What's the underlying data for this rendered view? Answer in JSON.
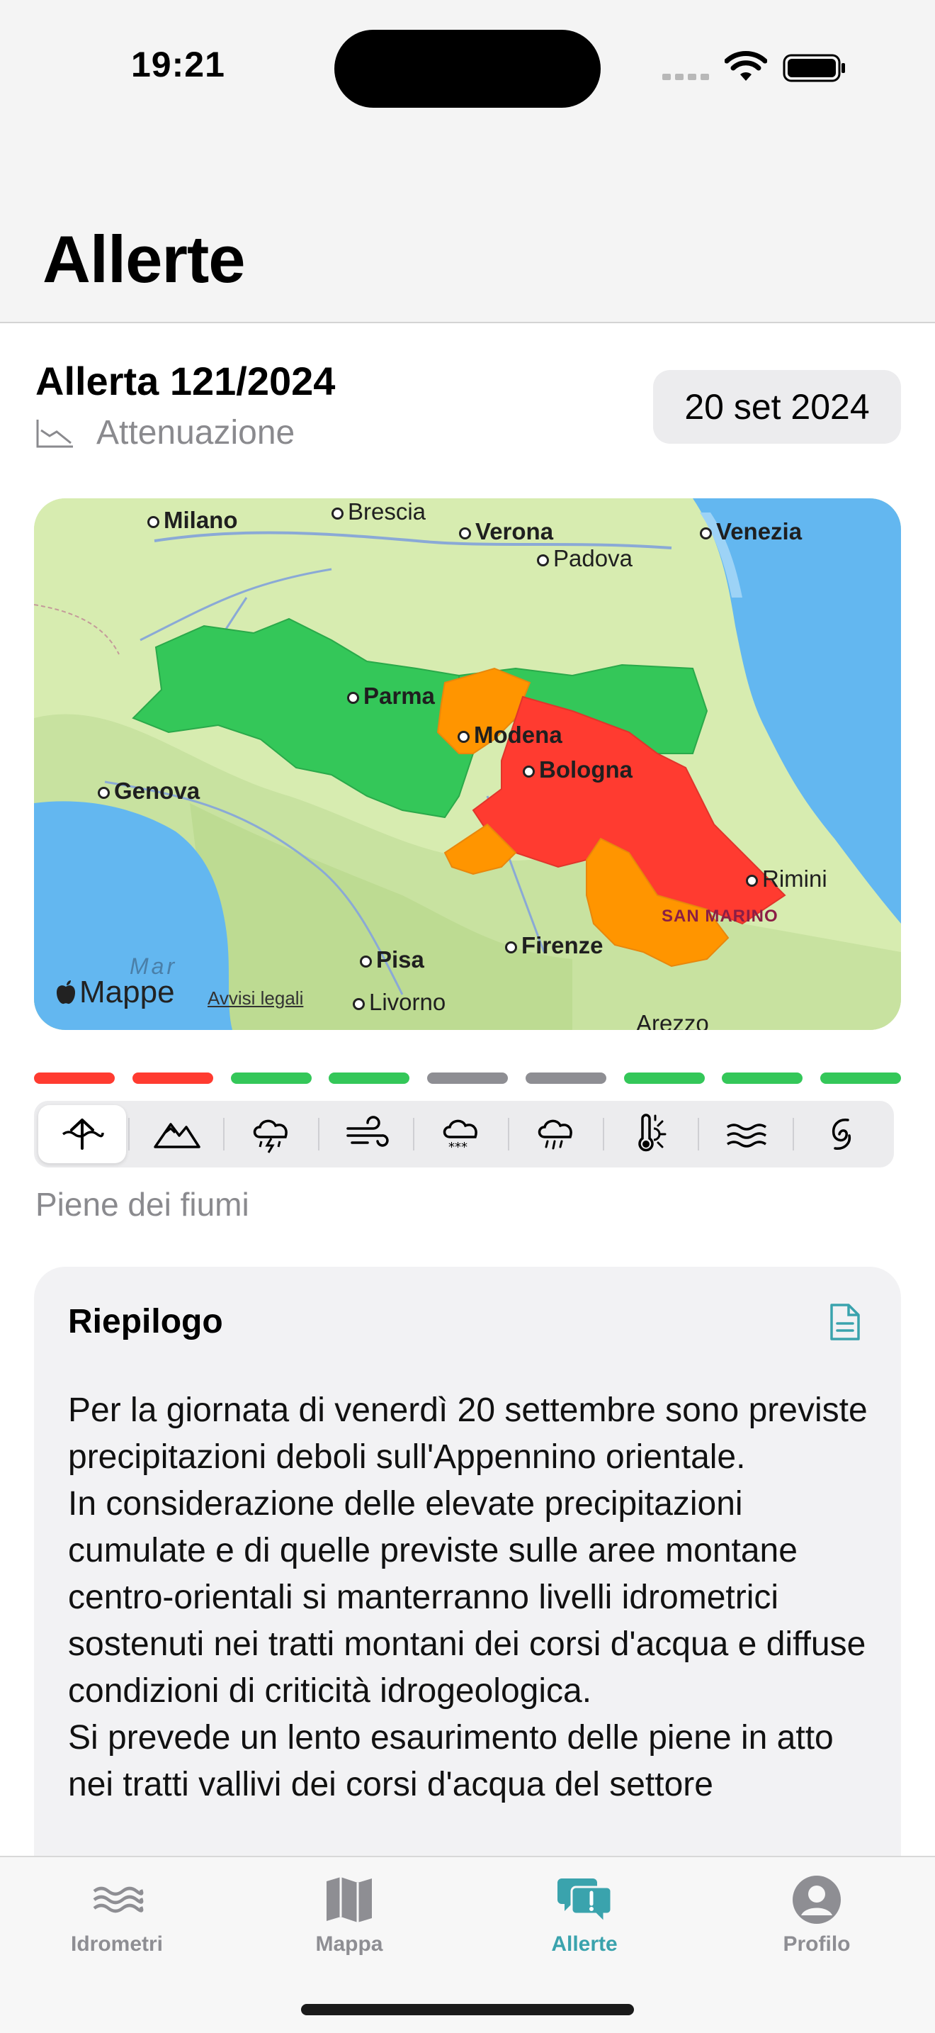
{
  "status_bar": {
    "time": "19:21"
  },
  "header": {
    "title": "Allerte"
  },
  "alert": {
    "title": "Allerta 121/2024",
    "trend": "Attenuazione",
    "date": "20 set 2024"
  },
  "map": {
    "cities": [
      {
        "name": "Milano"
      },
      {
        "name": "Brescia"
      },
      {
        "name": "Verona"
      },
      {
        "name": "Padova"
      },
      {
        "name": "Venezia"
      },
      {
        "name": "Parma"
      },
      {
        "name": "Modena"
      },
      {
        "name": "Bologna"
      },
      {
        "name": "Genova"
      },
      {
        "name": "Rimini"
      },
      {
        "name": "Pisa"
      },
      {
        "name": "Firenze"
      },
      {
        "name": "Livorno"
      },
      {
        "name": "Arezzo"
      }
    ],
    "state_label": "SAN MARINO",
    "sea_label": "Mar",
    "logo_label": "Mappe",
    "legal_label": "Avvisi legali",
    "region_colors": {
      "green": "#34c759",
      "orange": "#ff9500",
      "red": "#ff3b30"
    }
  },
  "risk_levels": [
    "red",
    "red",
    "green",
    "green",
    "gray",
    "gray",
    "green",
    "green",
    "green"
  ],
  "risk_colors": {
    "red": "#ff3b30",
    "green": "#34c759",
    "gray": "#8e8e93"
  },
  "risk_tabs": [
    {
      "icon": "river-flood-icon",
      "active": true
    },
    {
      "icon": "mountains-icon",
      "active": false
    },
    {
      "icon": "thunderstorm-icon",
      "active": false
    },
    {
      "icon": "wind-icon",
      "active": false
    },
    {
      "icon": "snow-icon",
      "active": false
    },
    {
      "icon": "ice-rain-icon",
      "active": false
    },
    {
      "icon": "temperature-icon",
      "active": false
    },
    {
      "icon": "sea-waves-icon",
      "active": false
    },
    {
      "icon": "cyclone-icon",
      "active": false
    }
  ],
  "selected_risk_caption": "Piene dei fiumi",
  "summary": {
    "title": "Riepilogo",
    "paragraphs": [
      "Per la giornata di venerdì 20 settembre sono previste precipitazioni deboli sull'Appennino orientale.",
      "In considerazione delle elevate precipitazioni cumulate e di quelle previste sulle aree montane centro-orientali si manterranno livelli idrometrici sostenuti nei tratti montani dei corsi d'acqua e diffuse condizioni di criticità idrogeologica.",
      "Si prevede un lento esaurimento delle piene in atto nei tratti vallivi dei corsi d'acqua del settore"
    ]
  },
  "tab_bar": {
    "items": [
      {
        "label": "Idrometri",
        "icon": "water-waves-icon"
      },
      {
        "label": "Mappa",
        "icon": "map-icon"
      },
      {
        "label": "Allerte",
        "icon": "alert-bubble-icon"
      },
      {
        "label": "Profilo",
        "icon": "person-icon"
      }
    ],
    "active": "Allerte",
    "accent_color": "#3aa3ad"
  }
}
